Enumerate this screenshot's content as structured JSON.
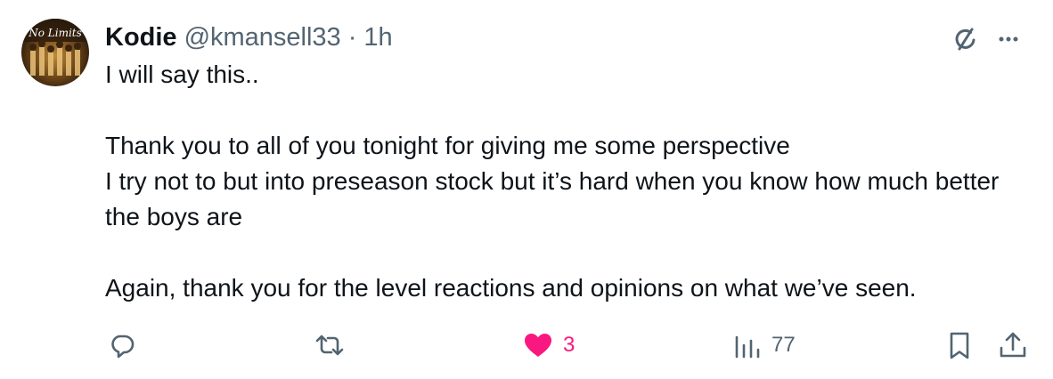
{
  "author": {
    "name": "Kodie",
    "handle": "@kmansell33",
    "separator": "·",
    "time": "1h",
    "avatar_text": "No Limits"
  },
  "tweet": {
    "paragraphs": [
      "I will say this..",
      "Thank you to all of you tonight for giving me some perspective\nI try not to but into preseason stock but it’s hard when you know how much better the boys are",
      "Again, thank you for the level reactions and opinions on what we’ve seen."
    ]
  },
  "actions": {
    "reply_icon": "reply-icon",
    "retweet_icon": "retweet-icon",
    "like_icon": "heart-icon",
    "like_count": "3",
    "views_icon": "views-icon",
    "views_count": "77",
    "bookmark_icon": "bookmark-icon",
    "share_icon": "share-icon"
  },
  "colors": {
    "text": "#0f1419",
    "muted": "#536471",
    "like": "#f91880"
  }
}
